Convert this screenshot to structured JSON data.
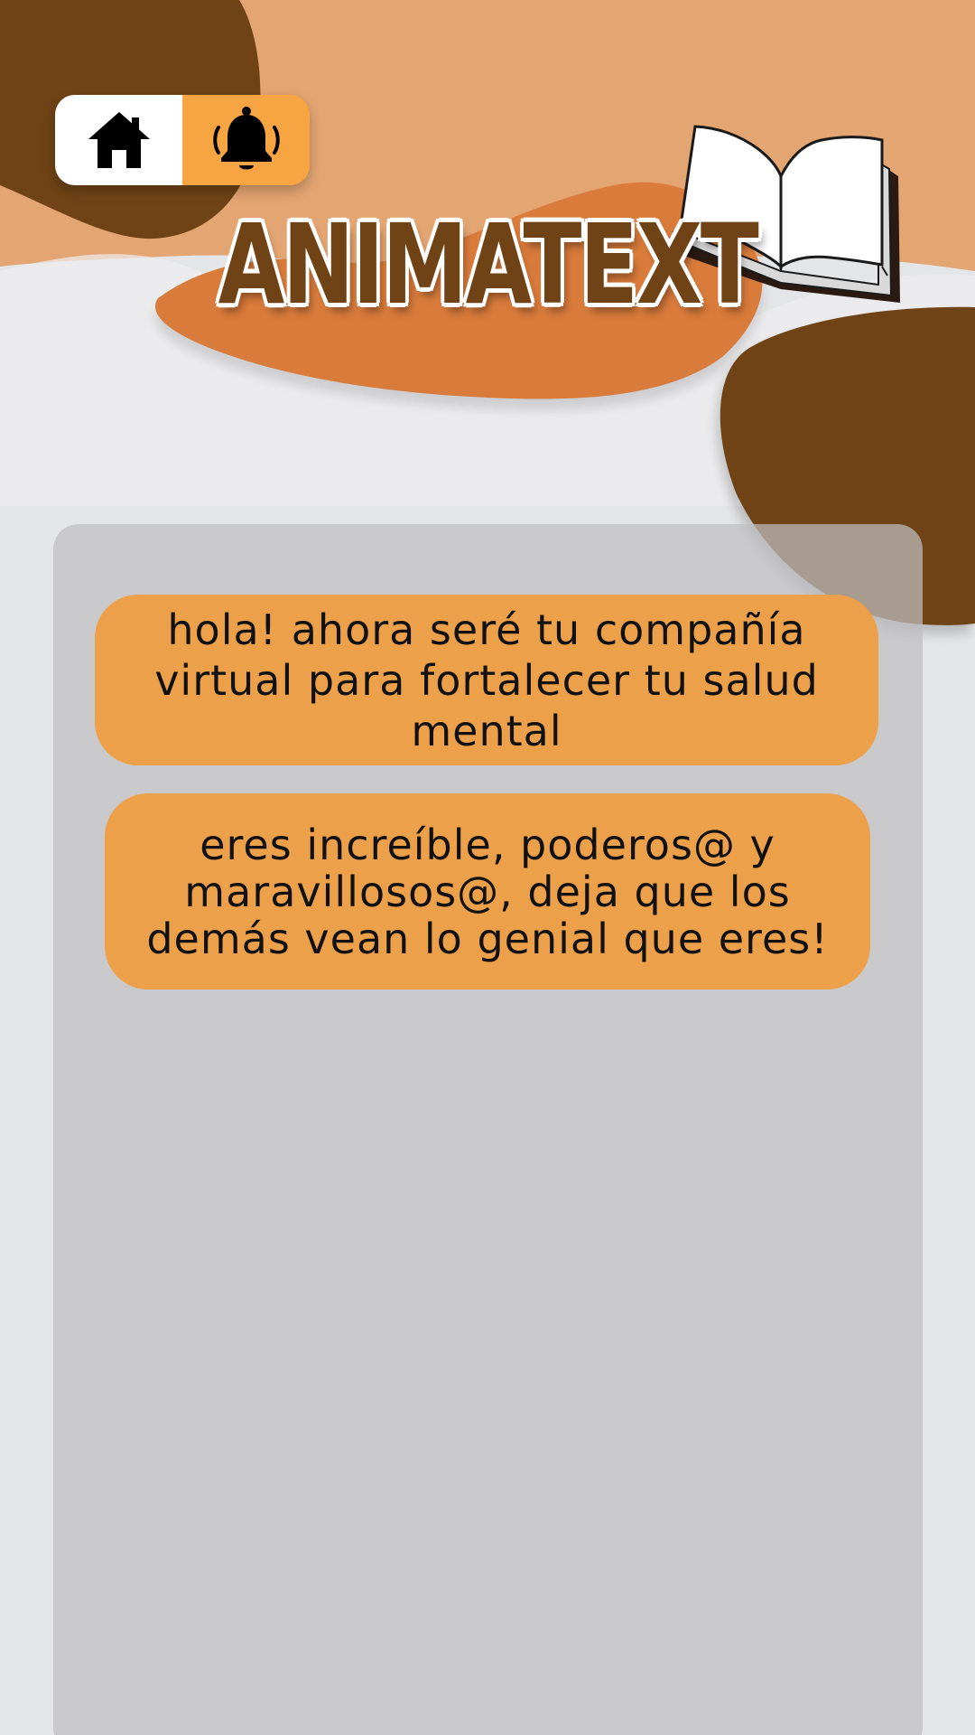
{
  "app": {
    "title": "ANIMATEXT"
  },
  "nav": {
    "items": [
      {
        "icon": "home-icon"
      },
      {
        "icon": "bell-icon"
      }
    ]
  },
  "messages": [
    {
      "text": "hola! ahora seré tu compañía virtual para fortalecer tu salud mental"
    },
    {
      "text": "eres increíble, poderos@ y maravillosos@, deja que los demás vean lo genial que eres!"
    }
  ],
  "colors": {
    "brown": "#6f4315",
    "orange": "#eda04a",
    "light_orange": "#e3a572",
    "accent_orange": "#d97b3b",
    "panel_gray": "#c8c8c9",
    "background": "#e4e5e7"
  }
}
